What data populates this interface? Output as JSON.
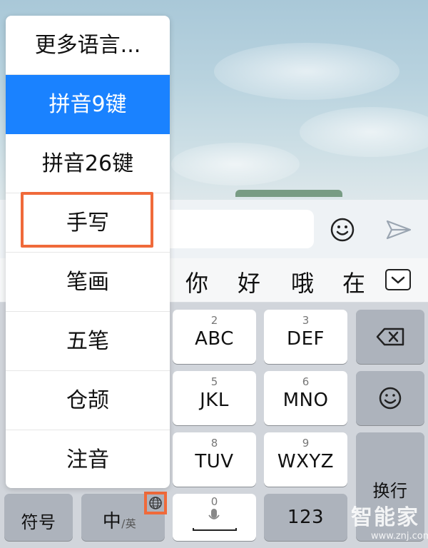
{
  "menu": {
    "items": [
      {
        "label": "更多语言..."
      },
      {
        "label": "拼音9键"
      },
      {
        "label": "拼音26键"
      },
      {
        "label": "手写"
      },
      {
        "label": "笔画"
      },
      {
        "label": "五笔"
      },
      {
        "label": "仓颉"
      },
      {
        "label": "注音"
      }
    ],
    "selected_index": 1
  },
  "candidates": [
    "你",
    "好",
    "哦",
    "在"
  ],
  "keyboard": {
    "keys": [
      {
        "num": "2",
        "label": "ABC"
      },
      {
        "num": "3",
        "label": "DEF"
      },
      {
        "num": "5",
        "label": "JKL"
      },
      {
        "num": "6",
        "label": "MNO"
      },
      {
        "num": "8",
        "label": "TUV"
      },
      {
        "num": "9",
        "label": "WXYZ"
      }
    ],
    "symbol_label": "符号",
    "lang_main": "中",
    "lang_alt": "/英",
    "space_num": "0",
    "num_label": "123",
    "enter_label": "换行"
  },
  "icons": {
    "emoji": "smiley-icon",
    "send": "send-icon",
    "collapse": "chevron-down-icon",
    "backspace": "backspace-icon",
    "globe": "globe-icon",
    "mic": "microphone-icon"
  },
  "colors": {
    "selected": "#1a82ff",
    "highlight": "#f06a3a"
  },
  "watermark": {
    "text": "智能家",
    "url": "www.znj.com"
  }
}
